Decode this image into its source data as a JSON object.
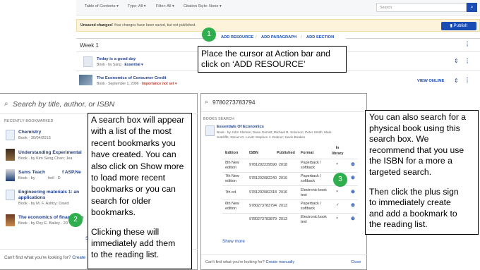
{
  "toolbar": {
    "toc": "Table of Contents ▾",
    "type": "Type: All ▾",
    "filter": "Filter: All ▾",
    "citation": "Citation Style: None ▾",
    "search_placeholder": "Search"
  },
  "unsaved": {
    "bold": "Unsaved changes!",
    "text": " Your changes have been saved, but not published.",
    "publish": "Publish"
  },
  "action_bar": {
    "add_resource": "ADD RESOURCE",
    "add_paragraph": "ADD PARAGRAPH",
    "add_section": "ADD SECTION",
    "sep": "/"
  },
  "week": {
    "label": "Week 1"
  },
  "items": [
    {
      "title": "Today is a good day",
      "meta": "Book  ·  by Sang  ·  ",
      "badge": "Essential ▾"
    },
    {
      "title": "The Economics of Consumer Credit",
      "meta": "Book  ·  September 1, 2006  ·  ",
      "badge": "Importance not set ▾",
      "action": "VIEW ONLINE"
    }
  ],
  "callout1": {
    "line1": "Place the cursor at Action bar and",
    "line2": "click on ‘ADD RESOURCE’"
  },
  "steps": {
    "one": "1",
    "two": "2",
    "three": "3"
  },
  "left_panel": {
    "search_placeholder": "Search by title, author, or ISBN",
    "heading": "RECENTLY BOOKMARKED",
    "bookmarks": [
      {
        "title": "Chemistry",
        "meta": "Book  ·  30/04/2013"
      },
      {
        "title": "Understanding Experimental",
        "meta": "Book  ·  by Kim Seng Chan; Jea"
      },
      {
        "title": "Sams Teach",
        "title_tail": "f ASP.Ne",
        "meta": "Book  ·  by",
        "meta_tail": "hell  ·  D"
      },
      {
        "title": "Engineering materials 1: an",
        "title2": "applications",
        "meta": "Book  ·  by M. F. Ashby; David"
      },
      {
        "title": "The economics of financial m",
        "meta": "Book  ·  by Roy E. Bailey  ·  20"
      }
    ],
    "show_more_partial": "S",
    "footer_text": "Can't find what you're looking for?",
    "footer_link": "Create"
  },
  "callout2": [
    "A search box will appear",
    "with a list of the most",
    "recent bookmarks you",
    "have created. You can",
    "also click on Show more",
    "to load more recent",
    "bookmarks or you can",
    "search for older",
    "bookmarks.",
    "",
    "Clicking these will",
    "immediately add them",
    "to the reading list."
  ],
  "mid_panel": {
    "search_value": "9780273783794",
    "heading": "BOOKS SEARCH",
    "book_title": "Essentials Of Economics",
    "book_meta1": "Book  ·  by John Sloman; Dean Garratt; Michael B. Solomon; Peter Smith; Mark",
    "book_meta2": "Sutcliffe; Steven D. Levitt; Stephen J. Dubner; Kevin Boakes",
    "columns": [
      "Edition",
      "ISBN",
      "Published",
      "Format",
      "In library"
    ],
    "rows": [
      {
        "edition": "8th New edition",
        "isbn": "9781292239590",
        "published": "2018",
        "format": "Paperback / softback",
        "in_library": "×"
      },
      {
        "edition": "7th New edition",
        "isbn": "9781292082240",
        "published": "2016",
        "format": "Paperback / softback",
        "in_library": "×"
      },
      {
        "edition": "7th ed.",
        "isbn": "9781292082318",
        "published": "2016",
        "format": "Electronic book text",
        "in_library": "×"
      },
      {
        "edition": "6th New edition",
        "isbn": "9780273783794",
        "published": "2013",
        "format": "Paperback / softback",
        "in_library": "✓"
      },
      {
        "edition": "",
        "isbn": "9780273783879",
        "published": "2013",
        "format": "Electronic book text",
        "in_library": "×"
      }
    ],
    "show_more": "Show more",
    "footer_text": "Can't find what you're looking for?",
    "footer_link": "Create manually",
    "close": "Close"
  },
  "callout3": [
    "You can also search for a",
    "physical book using this",
    "search box. We",
    "recommend that you use",
    "the ISBN for a more a",
    "targeted search.",
    "",
    "Then click the plus sign",
    "to immediately create",
    "and add a bookmark to",
    "the reading list."
  ],
  "colors": {
    "accent": "#1a4db3",
    "step": "#2fae4e",
    "warning_bg": "#fcf3da"
  }
}
